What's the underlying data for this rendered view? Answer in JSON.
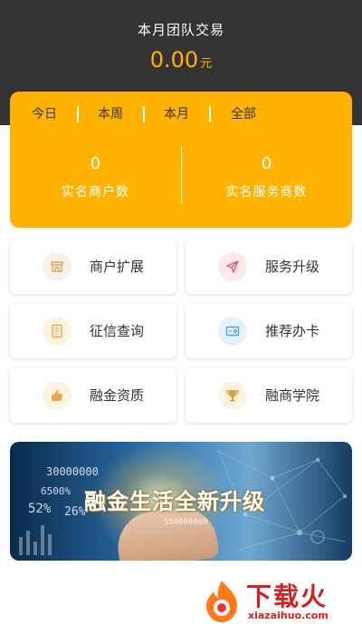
{
  "header": {
    "title": "本月团队交易",
    "amount": "0.00",
    "unit": "元"
  },
  "tabs": [
    {
      "label": "今日"
    },
    {
      "label": "本周"
    },
    {
      "label": "本月"
    },
    {
      "label": "全部"
    }
  ],
  "stats": [
    {
      "value": "0",
      "label": "实名商户数"
    },
    {
      "value": "0",
      "label": "实名服务商数"
    }
  ],
  "menu": [
    {
      "label": "商户扩展",
      "icon": "store-icon"
    },
    {
      "label": "服务升级",
      "icon": "paper-plane-icon"
    },
    {
      "label": "征信查询",
      "icon": "document-icon"
    },
    {
      "label": "推荐办卡",
      "icon": "card-icon"
    },
    {
      "label": "融金资质",
      "icon": "thumbs-up-icon"
    },
    {
      "label": "融商学院",
      "icon": "trophy-icon"
    }
  ],
  "banner": {
    "title": "融金生活全新升级",
    "numbers": [
      "30000000",
      "6500%",
      "52%",
      "26%",
      "550000000"
    ]
  },
  "watermark": {
    "name": "下载火",
    "url": "xiazaihuo.com"
  },
  "colors": {
    "header_bg": "#333333",
    "accent": "#ffb300",
    "card_bg": "#ffffff",
    "watermark": "#d32222"
  }
}
